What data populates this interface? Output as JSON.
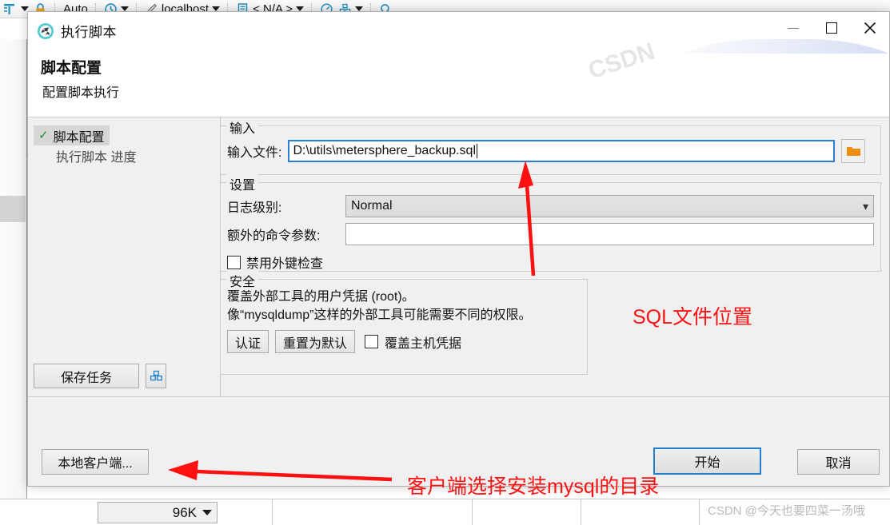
{
  "background_app": {
    "toolbar": {
      "items": [
        {
          "icon": "table-structure-icon",
          "label": ""
        },
        {
          "icon": "lock-icon",
          "label": ""
        },
        {
          "icon": "",
          "label": "Auto"
        },
        {
          "icon": "history-clock-icon",
          "label": ""
        },
        {
          "icon": "pencil-icon",
          "label": "localhost"
        },
        {
          "icon": "database-document-icon",
          "label": "< N/A >"
        },
        {
          "icon": "gauge-icon",
          "label": ""
        },
        {
          "icon": "grid-boxes-icon",
          "label": ""
        },
        {
          "icon": "search-icon",
          "label": ""
        }
      ]
    },
    "status_value": "96K"
  },
  "dialog": {
    "title": "执行脚本",
    "icon": "dolphin-icon",
    "window_buttons": {
      "minimize": "minimize-icon",
      "maximize": "maximize-icon",
      "close": "close-icon"
    },
    "header": {
      "title": "脚本配置",
      "subtitle": "配置脚本执行"
    },
    "tree": {
      "items": [
        {
          "label": "脚本配置",
          "selected": true,
          "checked": true
        },
        {
          "label": "执行脚本 进度",
          "selected": false,
          "checked": false
        }
      ],
      "save_task_button": "保存任务",
      "save_task_icon": "package-boxes-icon"
    },
    "groups": {
      "input": {
        "legend": "输入",
        "file_label": "输入文件:",
        "file_value": "D:\\utils\\metersphere_backup.sql",
        "browse_icon": "folder-icon"
      },
      "settings": {
        "legend": "设置",
        "log_level_label": "日志级别:",
        "log_level_value": "Normal",
        "log_level_options": [
          "Normal"
        ],
        "extra_args_label": "额外的命令参数:",
        "extra_args_value": "",
        "disable_fk_label": "禁用外键检查",
        "disable_fk_checked": false
      },
      "security": {
        "legend": "安全",
        "line1": "覆盖外部工具的用户凭据 (root)。",
        "line2": "像“mysqldump”这样的外部工具可能需要不同的权限。",
        "auth_button": "认证",
        "reset_button": "重置为默认",
        "override_label": "覆盖主机凭据",
        "override_checked": false
      }
    },
    "footer": {
      "local_client_button": "本地客户端...",
      "start_button": "开始",
      "cancel_button": "取消"
    }
  },
  "annotations": {
    "sql_location": "SQL文件位置",
    "client_dir": "客户端选择安装mysql的目录",
    "color": "#ff1010",
    "arrows": [
      "arrow-to-input-file",
      "arrow-to-local-client"
    ]
  },
  "watermark": "CSDN @今天也要四菜一汤哦"
}
